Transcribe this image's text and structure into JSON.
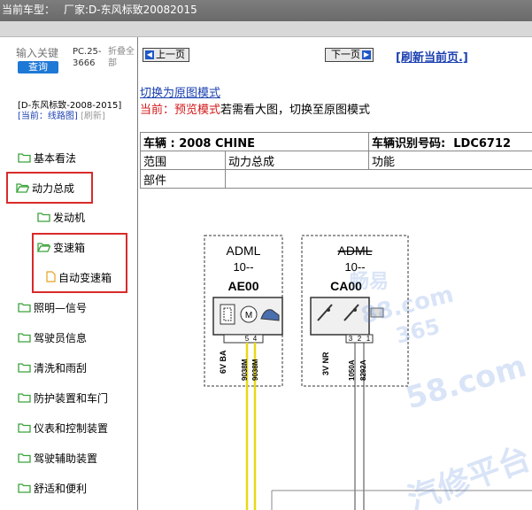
{
  "header": {
    "vehicle_label": "当前车型：",
    "maker_text": "厂家:D-东风标致20082015"
  },
  "sidebar": {
    "search_placeholder": "输入关键",
    "query_label": "查询",
    "pc_code": "PC.25-3666",
    "fold_all": "折叠全部",
    "crumb_root": "[D-东风标致-2008-2015]",
    "crumb_current": "[当前：线路图]",
    "crumb_refresh": "[刷新]",
    "items": [
      {
        "label": "基本看法",
        "kind": "folder"
      },
      {
        "label": "动力总成",
        "kind": "folder"
      },
      {
        "label": "发动机",
        "kind": "folder"
      },
      {
        "label": "变速箱",
        "kind": "folder"
      },
      {
        "label": "自动变速箱",
        "kind": "doc"
      },
      {
        "label": "照明—信号",
        "kind": "folder"
      },
      {
        "label": "驾驶员信息",
        "kind": "folder"
      },
      {
        "label": "清洗和雨刮",
        "kind": "folder"
      },
      {
        "label": "防护装置和车门",
        "kind": "folder"
      },
      {
        "label": "仪表和控制装置",
        "kind": "folder"
      },
      {
        "label": "驾驶辅助装置",
        "kind": "folder"
      },
      {
        "label": "舒适和便利",
        "kind": "folder"
      }
    ]
  },
  "content": {
    "prev_label": "上一页",
    "next_label": "下一页",
    "refresh_label": "[刷新当前页.]",
    "switch_link": "切换为原图模式",
    "mode_prefix": "当前：",
    "mode_name": "预览模式",
    "mode_suffix": "若需看大图，切换至原图模式",
    "table": {
      "vehicle": "车辆 : 2008 CHINE",
      "vin_label": "车辆识别号码:",
      "vin_value": "LDC6712",
      "range": "范围",
      "powertrain": "动力总成",
      "function": "功能",
      "parts": "部件"
    },
    "diagram": {
      "box1": {
        "name": "ADML",
        "sub": "10--",
        "code": "AE00",
        "pins": [
          "5",
          "4"
        ],
        "left_label": "6V BA",
        "wire1": "9038M",
        "wire2": "9038M"
      },
      "box2": {
        "name": "ADML",
        "sub": "10--",
        "code": "CA00",
        "pins": [
          "3",
          "2",
          "1"
        ],
        "left_label": "3V NR",
        "wire1": "1050A",
        "wire2": "8292A"
      }
    },
    "watermark": {
      "w1": "畅易",
      "w2": "88.com",
      "w3": "365",
      "w4": "58.com",
      "w5": "汽修平台"
    }
  }
}
